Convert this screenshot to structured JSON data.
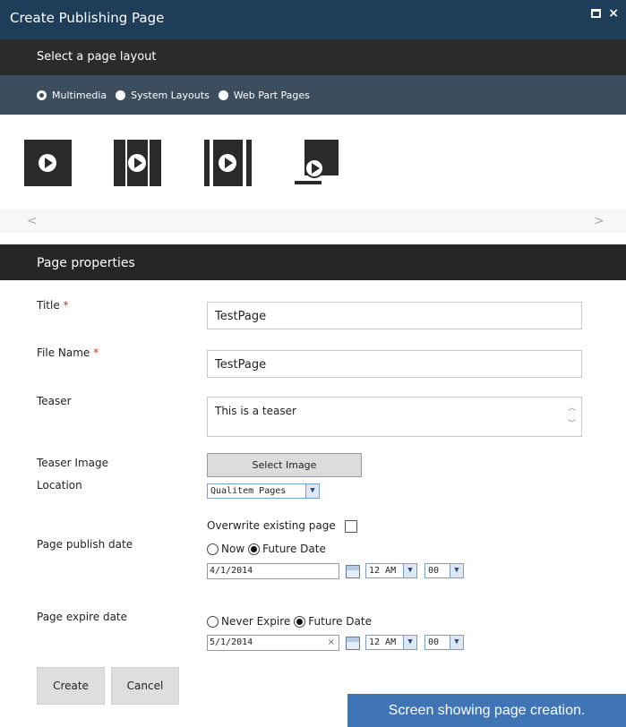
{
  "dialog": {
    "title": "Create Publishing Page",
    "select_layout_label": "Select a page layout",
    "layout_groups": [
      {
        "label": "Multimedia",
        "selected": true
      },
      {
        "label": "System Layouts",
        "selected": false
      },
      {
        "label": "Web Part Pages",
        "selected": false
      }
    ],
    "scroll_left": "<",
    "scroll_right": ">"
  },
  "properties": {
    "header": "Page properties",
    "title_label": "Title",
    "title_value": "TestPage",
    "file_name_label": "File Name",
    "file_name_value": "TestPage",
    "required_mark": "*",
    "teaser_label": "Teaser",
    "teaser_value": "This is a teaser",
    "teaser_image_label": "Teaser Image",
    "select_image_label": "Select Image",
    "location_label": "Location",
    "location_value": "Qualitem Pages",
    "overwrite_label": "Overwrite existing page",
    "publish_label": "Page publish date",
    "publish_now": "Now",
    "publish_future": "Future Date",
    "publish_date": "4/1/2014",
    "publish_hour": "12 AM",
    "publish_min": "00",
    "expire_label": "Page expire date",
    "expire_never": "Never Expire",
    "expire_future": "Future Date",
    "expire_date": "5/1/2014",
    "expire_hour": "12 AM",
    "expire_min": "00",
    "clear_mark": "×"
  },
  "buttons": {
    "create": "Create",
    "cancel": "Cancel"
  },
  "caption": "Screen showing page creation.",
  "colors": {
    "titlebar": "#1e3d59",
    "layout_bar": "#2b2b2b",
    "radio_bar": "#3c4d5d",
    "required": "#d83b01",
    "caption_bg": "#3f74b5"
  }
}
